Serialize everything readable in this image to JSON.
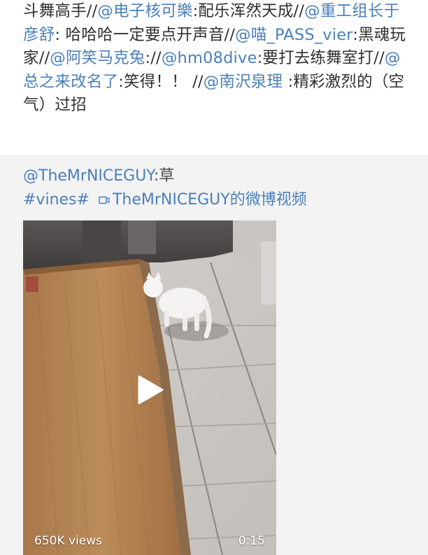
{
  "post": {
    "line1_a": "斗舞高手//",
    "line1_m1": "@电子核可樂",
    "line1_b": ":配乐浑然天成//",
    "line1_m2": "@重工组长于彦舒",
    "line1_c": ": 哈哈哈一定要点开声音//",
    "line1_m3": "@喵_PASS_vier",
    "line1_d": ":黑魂玩家//",
    "line1_m4": "@阿笑马克兔",
    "line1_e": "://",
    "line1_m5": "@hm08dive",
    "line1_f": ":要打去练舞室打//",
    "line1_m6": "@总之来改名了",
    "line1_g": ":笑得！！ //",
    "line1_m7": "@南沢泉理",
    "line1_h": " :精彩激烈的（空气）过招"
  },
  "repost": {
    "author_mention": "@TheMrNICEGUY",
    "author_text": ":草",
    "hashtag": "#vines#",
    "video_link_label": "TheMrNICEGUY的微博视频"
  },
  "video": {
    "views": "650K views",
    "duration": "0:15"
  },
  "colors": {
    "mention": "#4a7fbb",
    "card_background": "#f3f3f3",
    "text": "#2f2f2f"
  },
  "icons": {
    "video_link": "video-camera-icon",
    "play": "play-icon"
  }
}
